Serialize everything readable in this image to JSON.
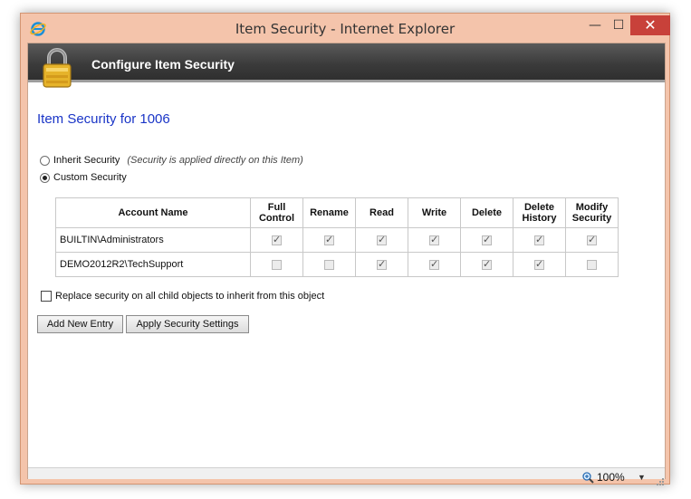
{
  "window": {
    "title": "Item Security - Internet Explorer",
    "minimize": "—",
    "maximize": "☐",
    "close": "✕"
  },
  "banner": {
    "title": "Configure Item Security"
  },
  "page": {
    "heading": "Item Security for 1006"
  },
  "options": {
    "inherit_label": "Inherit Security",
    "inherit_note": "(Security is applied directly on this Item)",
    "custom_label": "Custom Security",
    "selected": "custom"
  },
  "table": {
    "headers": [
      {
        "line1": "Account Name",
        "line2": ""
      },
      {
        "line1": "Full",
        "line2": "Control"
      },
      {
        "line1": "Rename",
        "line2": ""
      },
      {
        "line1": "Read",
        "line2": ""
      },
      {
        "line1": "Write",
        "line2": ""
      },
      {
        "line1": "Delete",
        "line2": ""
      },
      {
        "line1": "Delete",
        "line2": "History"
      },
      {
        "line1": "Modify",
        "line2": "Security"
      }
    ],
    "rows": [
      {
        "account": "BUILTIN\\Administrators",
        "perms": [
          true,
          true,
          true,
          true,
          true,
          true,
          true
        ]
      },
      {
        "account": "DEMO2012R2\\TechSupport",
        "perms": [
          false,
          false,
          true,
          true,
          true,
          true,
          false
        ]
      }
    ]
  },
  "replace": {
    "label": "Replace security on all child objects to inherit from this object",
    "checked": false
  },
  "buttons": {
    "add": "Add New Entry",
    "apply": "Apply Security Settings"
  },
  "status": {
    "zoom": "100%"
  },
  "colors": {
    "heading": "#1a35c7",
    "close": "#c8413a",
    "banner": "#3a3a3a"
  }
}
